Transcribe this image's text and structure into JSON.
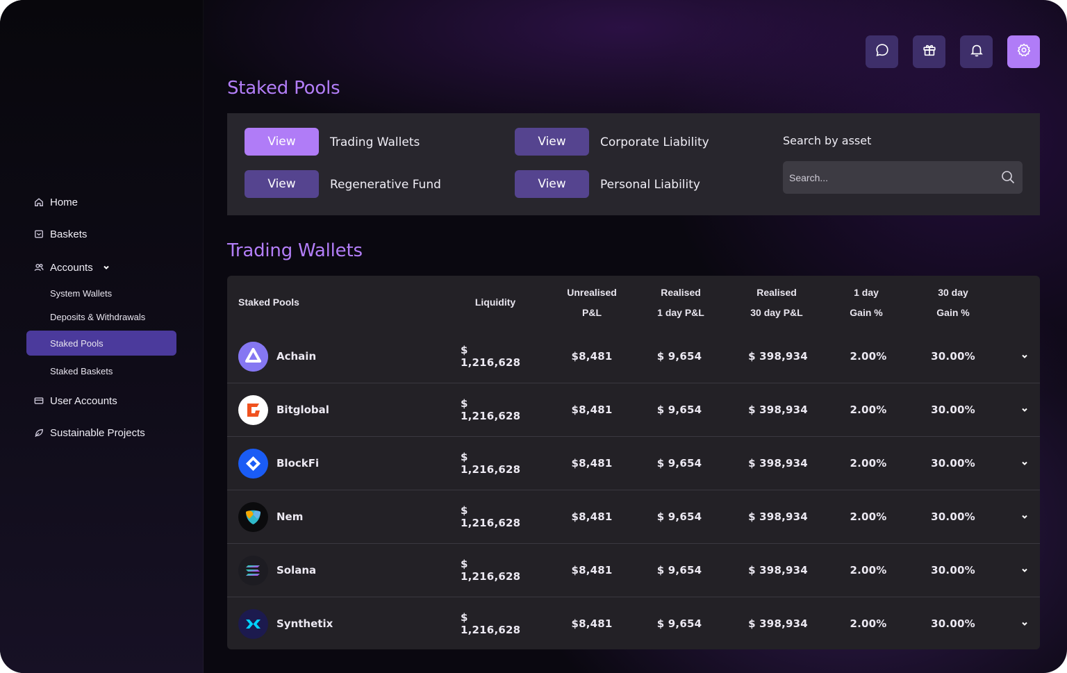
{
  "sidebar": {
    "home": "Home",
    "baskets": "Baskets",
    "accounts": "Accounts",
    "sub_items": [
      "System Wallets",
      "Deposits & Withdrawals",
      "Staked Pools",
      "Staked Baskets"
    ],
    "user_accounts": "User Accounts",
    "sustainable_projects": "Sustainable Projects"
  },
  "top_icons": [
    "chat-icon",
    "gift-icon",
    "bell-icon",
    "settings-icon"
  ],
  "staked_pools_title": "Staked Pools",
  "filter": {
    "buttons": [
      {
        "button": "View",
        "label": "Trading Wallets"
      },
      {
        "button": "View",
        "label": "Corporate Liability"
      },
      {
        "button": "View",
        "label": "Regenerative Fund"
      },
      {
        "button": "View",
        "label": "Personal Liability"
      }
    ],
    "search_label": "Search by asset",
    "search_placeholder": "Search..."
  },
  "trading_wallets_title": "Trading Wallets",
  "table": {
    "headers": {
      "pools": "Staked Pools",
      "liquidity": "Liquidity",
      "unrealised_1": "Unrealised",
      "unrealised_2": "P&L",
      "realised1_1": "Realised",
      "realised1_2": "1 day P&L",
      "realised30_1": "Realised",
      "realised30_2": "30 day P&L",
      "gain1_1": "1 day",
      "gain1_2": "Gain %",
      "gain30_1": "30 day",
      "gain30_2": "Gain %"
    },
    "rows": [
      {
        "name": "Achain",
        "liquidity": "$ 1,216,628",
        "unrealised": "$8,481",
        "realised_1d": "$ 9,654",
        "realised_30d": "$ 398,934",
        "gain_1d": "2.00%",
        "gain_30d": "30.00%"
      },
      {
        "name": "Bitglobal",
        "liquidity": "$ 1,216,628",
        "unrealised": "$8,481",
        "realised_1d": "$ 9,654",
        "realised_30d": "$ 398,934",
        "gain_1d": "2.00%",
        "gain_30d": "30.00%"
      },
      {
        "name": "BlockFi",
        "liquidity": "$ 1,216,628",
        "unrealised": "$8,481",
        "realised_1d": "$ 9,654",
        "realised_30d": "$ 398,934",
        "gain_1d": "2.00%",
        "gain_30d": "30.00%"
      },
      {
        "name": "Nem",
        "liquidity": "$ 1,216,628",
        "unrealised": "$8,481",
        "realised_1d": "$ 9,654",
        "realised_30d": "$ 398,934",
        "gain_1d": "2.00%",
        "gain_30d": "30.00%"
      },
      {
        "name": "Solana",
        "liquidity": "$ 1,216,628",
        "unrealised": "$8,481",
        "realised_1d": "$ 9,654",
        "realised_30d": "$ 398,934",
        "gain_1d": "2.00%",
        "gain_30d": "30.00%"
      },
      {
        "name": "Synthetix",
        "liquidity": "$ 1,216,628",
        "unrealised": "$8,481",
        "realised_1d": "$ 9,654",
        "realised_30d": "$ 398,934",
        "gain_1d": "2.00%",
        "gain_30d": "30.00%"
      }
    ]
  },
  "colors": {
    "accent": "#b07cf7",
    "button": "#55448f",
    "active_nav": "#4b3a9c"
  }
}
